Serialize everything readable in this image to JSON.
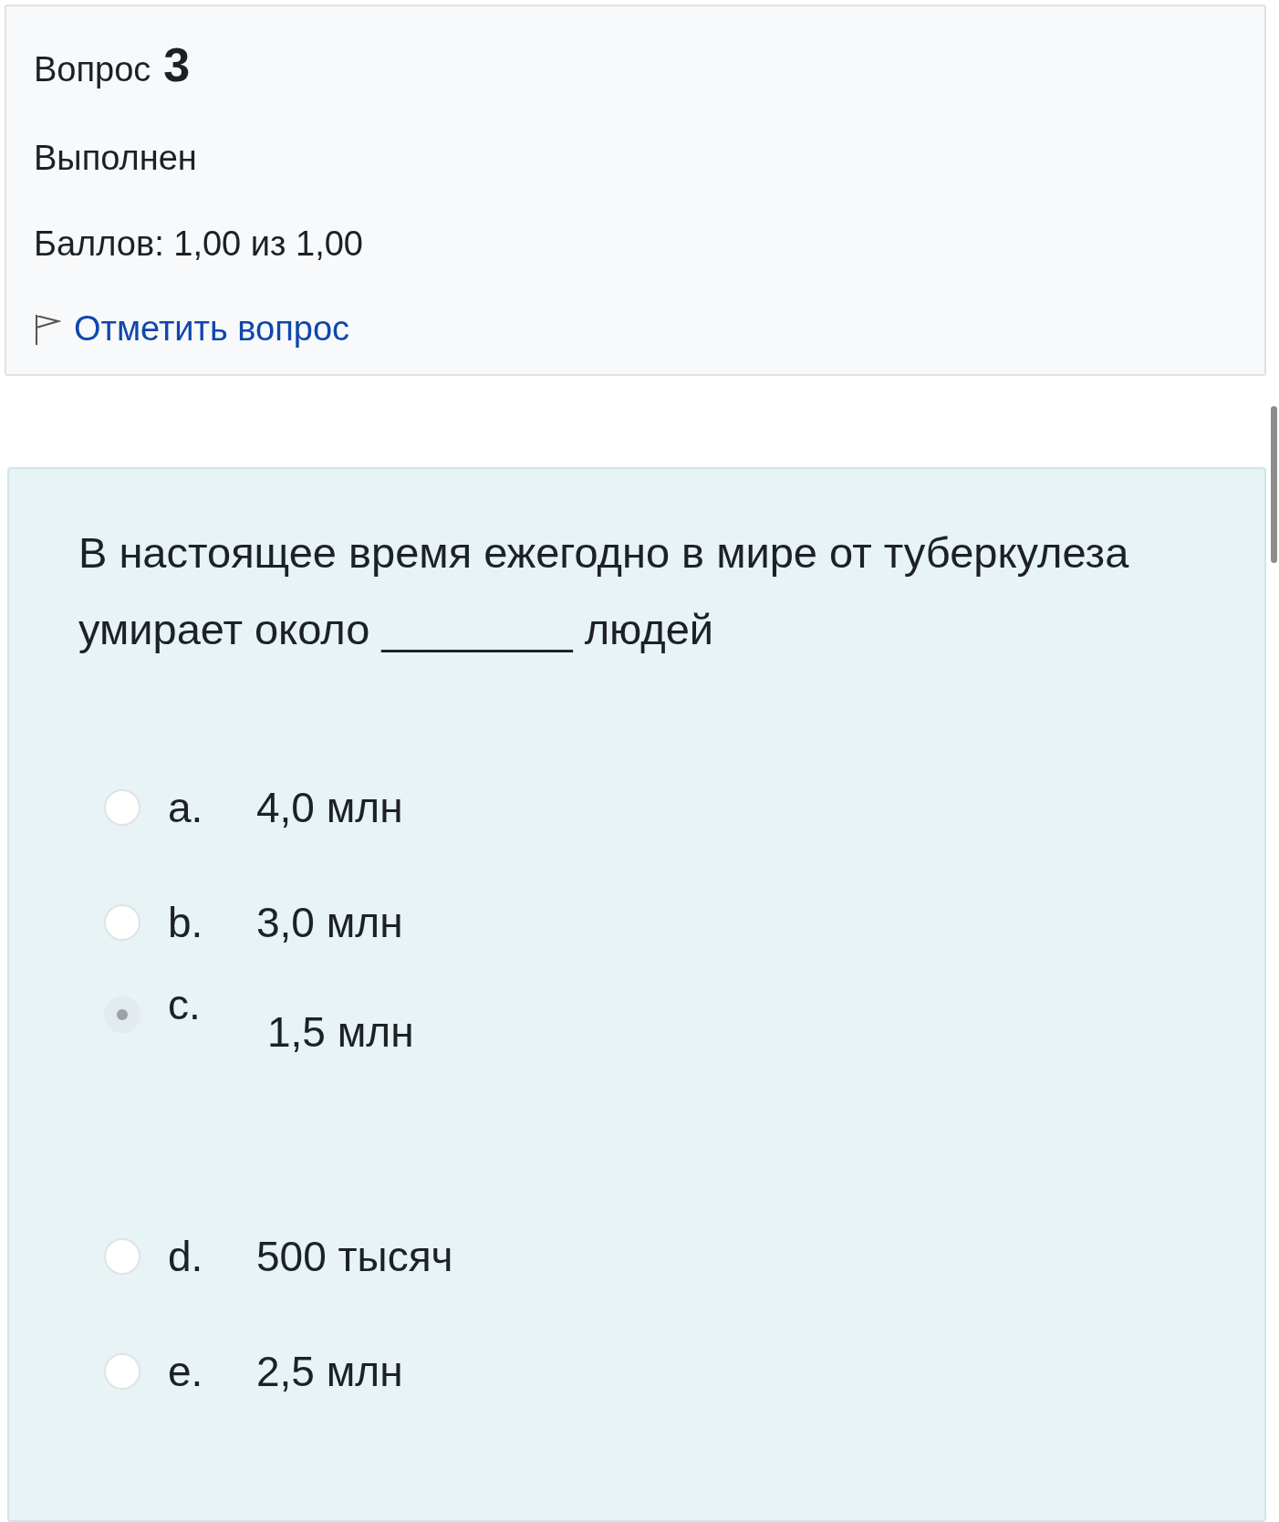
{
  "info": {
    "question_label": "Вопрос",
    "question_number": "3",
    "status": "Выполнен",
    "grade": "Баллов: 1,00 из 1,00",
    "flag_link": "Отметить вопрос"
  },
  "question": {
    "text": "В настоящее время ежегодно в мире от туберкулеза умирает около ________ людей",
    "options": [
      {
        "letter": "a.",
        "text": "4,0 млн",
        "selected": false
      },
      {
        "letter": "b.",
        "text": "3,0 млн",
        "selected": false
      },
      {
        "letter": "c.",
        "text": "1,5 млн",
        "selected": true
      },
      {
        "letter": "d.",
        "text": "500 тысяч",
        "selected": false
      },
      {
        "letter": "e.",
        "text": "2,5 млн",
        "selected": false
      }
    ]
  }
}
